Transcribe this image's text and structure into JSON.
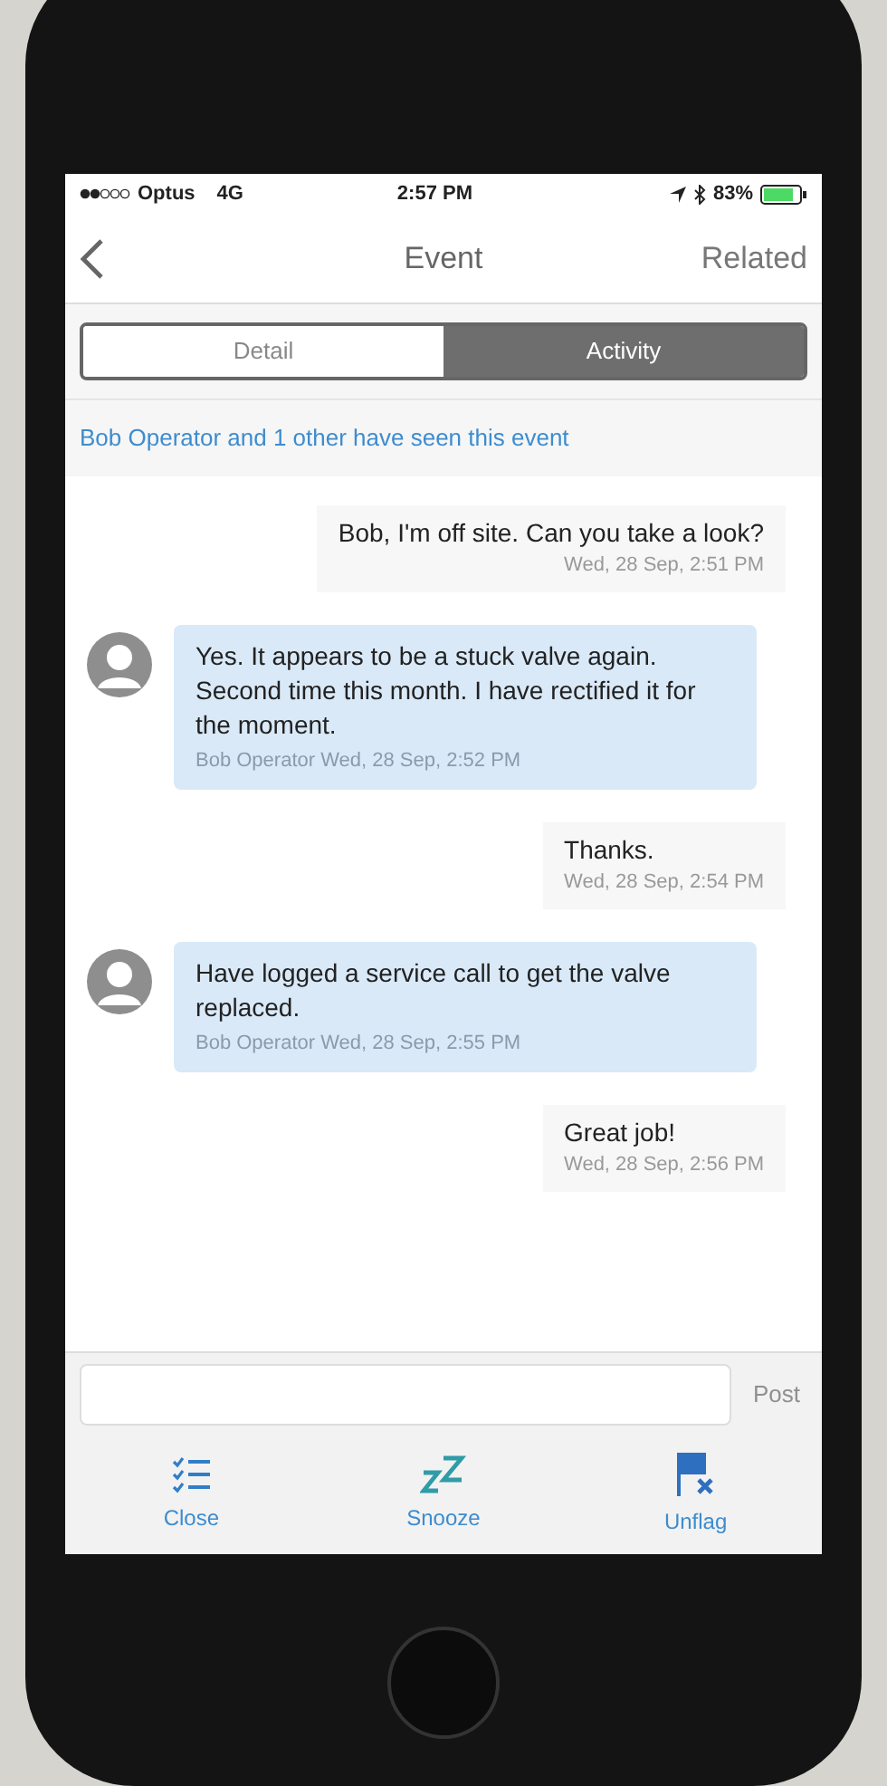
{
  "status_bar": {
    "carrier": "Optus",
    "network": "4G",
    "time": "2:57 PM",
    "battery": "83%"
  },
  "nav": {
    "title": "Event",
    "action": "Related"
  },
  "tabs": [
    {
      "label": "Detail",
      "selected": false
    },
    {
      "label": "Activity",
      "selected": true
    }
  ],
  "seen_notice": "Bob Operator and 1 other have seen this event",
  "messages": [
    {
      "kind": "outgoing",
      "text": "Bob, I'm off site. Can you take a look?",
      "meta": "Wed, 28 Sep, 2:51 PM"
    },
    {
      "kind": "incoming",
      "text": "Yes. It appears to be a stuck valve again. Second time this month. I have rectified it for the moment.",
      "meta": "Bob Operator Wed, 28 Sep, 2:52 PM"
    },
    {
      "kind": "outgoing",
      "text": "Thanks.",
      "meta": "Wed, 28 Sep, 2:54 PM"
    },
    {
      "kind": "incoming",
      "text": "Have logged a service call to get the valve replaced.",
      "meta": "Bob Operator Wed, 28 Sep, 2:55 PM"
    },
    {
      "kind": "outgoing",
      "text": "Great job!",
      "meta": "Wed, 28 Sep, 2:56 PM"
    }
  ],
  "composer": {
    "button": "Post",
    "disabled": true
  },
  "actions": [
    {
      "kind": "close",
      "label": "Close"
    },
    {
      "kind": "snooze",
      "label": "Snooze"
    },
    {
      "kind": "unflag",
      "label": "Unflag"
    }
  ]
}
